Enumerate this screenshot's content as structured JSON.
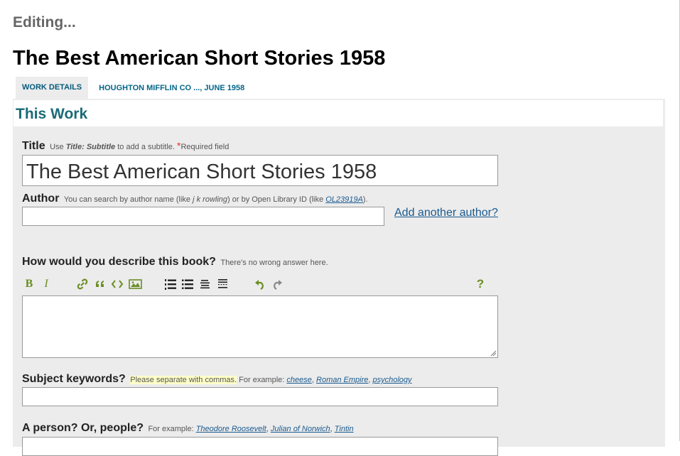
{
  "header": {
    "status": "Editing...",
    "book_title": "The Best American Short Stories 1958"
  },
  "tabs": [
    {
      "label": "WORK DETAILS",
      "active": true
    },
    {
      "label": "HOUGHTON MIFFLIN CO ..., JUNE 1958",
      "active": false
    }
  ],
  "section": {
    "heading": "This Work"
  },
  "title_field": {
    "label": "Title",
    "hint_use": "Use",
    "hint_example": "Title: Subtitle",
    "hint_rest": "to add a subtitle.",
    "required_mark": "*",
    "required_text": "Required field",
    "value": "The Best American Short Stories 1958"
  },
  "author_field": {
    "label": "Author",
    "hint_1": "You can search by author name (like",
    "hint_example_name": "j k rowling",
    "hint_2": ") or by Open Library ID (like",
    "hint_example_id": "OL23919A",
    "hint_3": ").",
    "value": "",
    "add_link": "Add another author?"
  },
  "description_field": {
    "label": "How would you describe this book?",
    "hint": "There's no wrong answer here.",
    "value": ""
  },
  "editor_toolbar": {
    "bold": "B",
    "italic": "I",
    "help": "?",
    "icons": [
      "bold-icon",
      "italic-icon",
      "link-icon",
      "quote-icon",
      "code-icon",
      "image-icon",
      "numbered-list-icon",
      "bulleted-list-icon",
      "heading-icon",
      "horizontal-rule-icon",
      "undo-icon",
      "redo-icon",
      "help-icon"
    ]
  },
  "subjects_field": {
    "label": "Subject keywords?",
    "hint_highlight": "Please separate with commas.",
    "hint_example": "For example:",
    "examples": [
      "cheese",
      "Roman Empire",
      "psychology"
    ],
    "value": ""
  },
  "people_field": {
    "label": "A person? Or, people?",
    "hint_example": "For example:",
    "examples": [
      "Theodore Roosevelt",
      "Julian of Norwich",
      "Tintin"
    ],
    "value": ""
  },
  "colors": {
    "accent": "#6b8e23",
    "link": "#1a5a8f",
    "heading": "#1b6b77",
    "required": "#e2341d"
  }
}
